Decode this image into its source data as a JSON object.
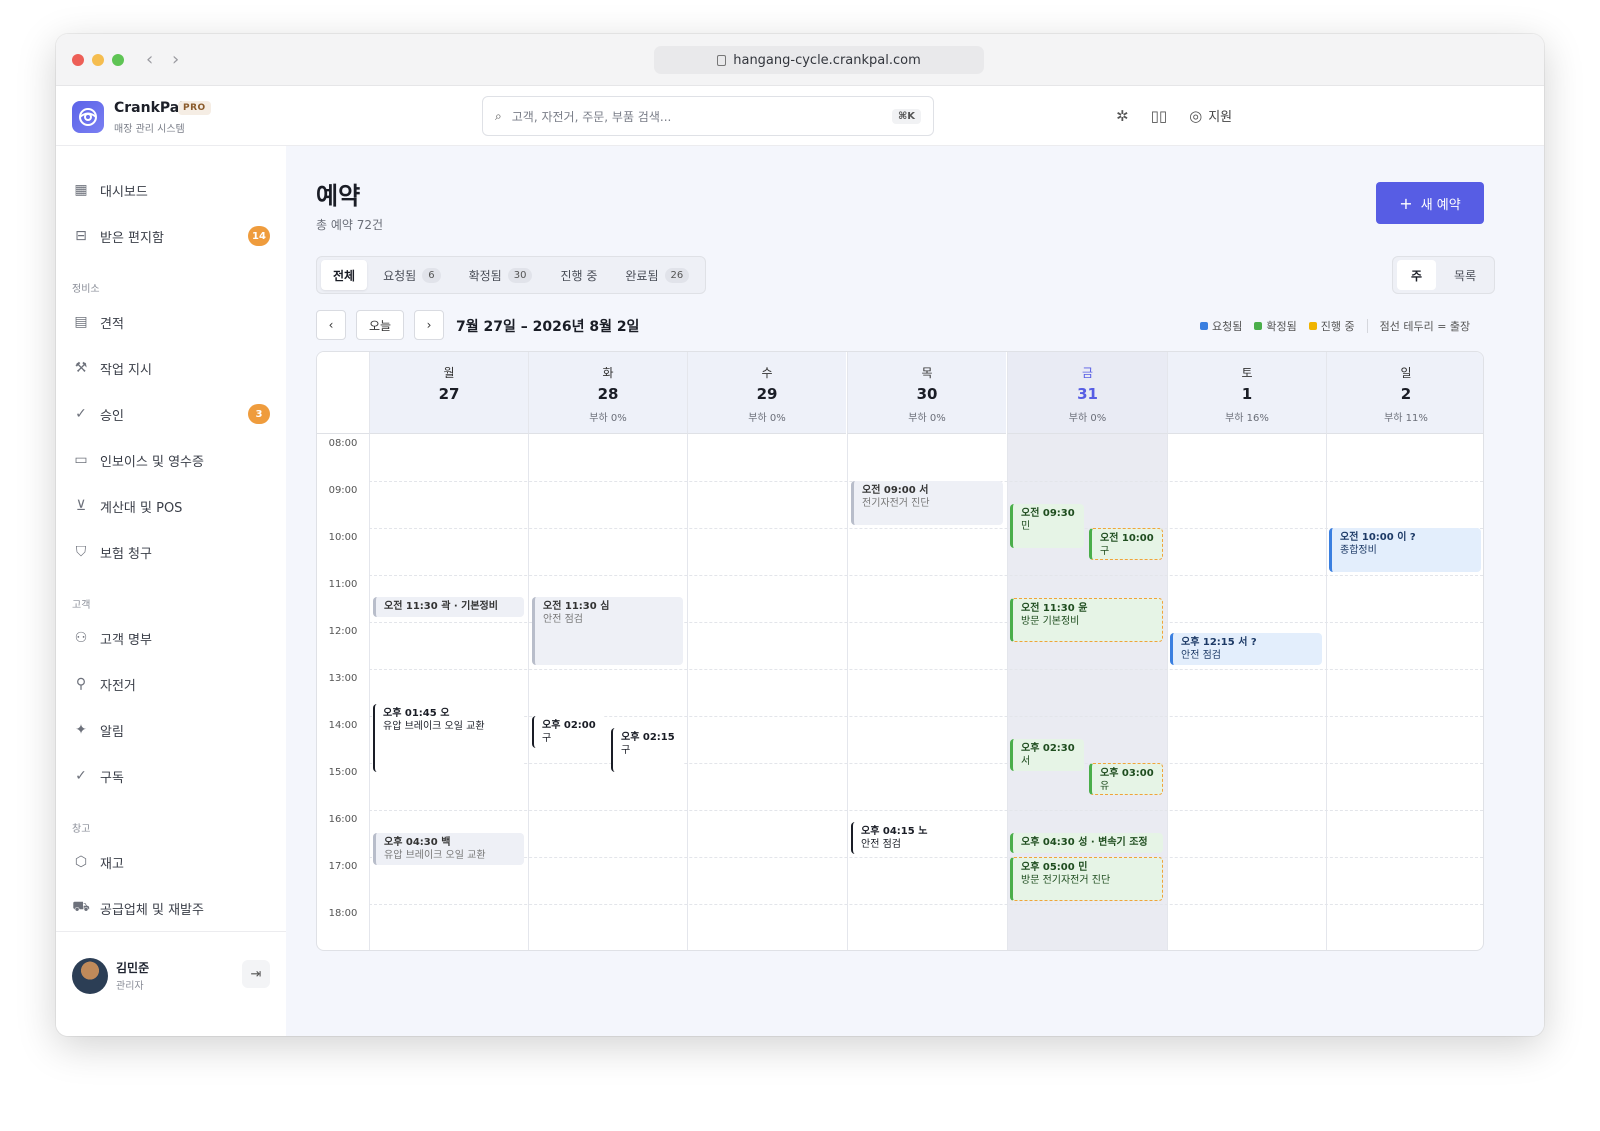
{
  "browser": {
    "url": "hangang-cycle.crankpal.com"
  },
  "brand": {
    "name": "CrankPal",
    "badge": "PRO",
    "subtitle": "매장 관리 시스템"
  },
  "search": {
    "placeholder": "고객, 자전거, 주문, 부품 검색...",
    "shortcut": "⌘K"
  },
  "topbar": {
    "support_label": "지원"
  },
  "sidebar": {
    "items": [
      {
        "label": "대시보드",
        "icon": "grid-icon"
      },
      {
        "label": "받은 편지함",
        "icon": "inbox-icon",
        "badge": "14"
      }
    ],
    "sections": [
      {
        "title": "정비소",
        "items": [
          {
            "label": "견적",
            "icon": "document-icon"
          },
          {
            "label": "작업 지시",
            "icon": "wrench-icon"
          },
          {
            "label": "승인",
            "icon": "check-circle-icon",
            "badge": "3"
          },
          {
            "label": "인보이스 및 영수증",
            "icon": "receipt-icon"
          },
          {
            "label": "계산대 및 POS",
            "icon": "cart-icon"
          },
          {
            "label": "보험 청구",
            "icon": "shield-icon"
          }
        ]
      },
      {
        "title": "고객",
        "items": [
          {
            "label": "고객 명부",
            "icon": "users-icon"
          },
          {
            "label": "자전거",
            "icon": "bicycle-icon"
          },
          {
            "label": "알림",
            "icon": "sparkle-icon"
          },
          {
            "label": "구독",
            "icon": "check-circle-icon"
          }
        ]
      },
      {
        "title": "창고",
        "items": [
          {
            "label": "재고",
            "icon": "box-icon"
          },
          {
            "label": "공급업체 및 재발주",
            "icon": "truck-icon"
          }
        ]
      }
    ]
  },
  "user": {
    "name": "김민준",
    "role": "관리자"
  },
  "page": {
    "title": "예약",
    "subtitle": "총 예약 72건",
    "new_button": "새 예약"
  },
  "tabs": [
    {
      "label": "전체",
      "count": ""
    },
    {
      "label": "요청됨",
      "count": "6"
    },
    {
      "label": "확정됨",
      "count": "30"
    },
    {
      "label": "진행 중",
      "count": ""
    },
    {
      "label": "완료됨",
      "count": "26"
    }
  ],
  "view_toggle": [
    "주",
    "목록"
  ],
  "nav": {
    "prev": "‹",
    "today": "오늘",
    "next": "›",
    "range": "7월 27일 – 2026년 8월 2일"
  },
  "legend": {
    "items": [
      {
        "label": "요청됨",
        "color": "#3a7fe0"
      },
      {
        "label": "확정됨",
        "color": "#4aae4a"
      },
      {
        "label": "진행 중",
        "color": "#f0b400"
      }
    ],
    "note": "점선 테두리 = 출장"
  },
  "calendar": {
    "hours": [
      "08:00",
      "09:00",
      "10:00",
      "11:00",
      "12:00",
      "13:00",
      "14:00",
      "15:00",
      "16:00",
      "17:00",
      "18:00"
    ],
    "days": [
      {
        "name": "월",
        "date": "27",
        "load": ""
      },
      {
        "name": "화",
        "date": "28",
        "load": "부하 0%"
      },
      {
        "name": "수",
        "date": "29",
        "load": "부하 0%"
      },
      {
        "name": "목",
        "date": "30",
        "load": "부하 0%"
      },
      {
        "name": "금",
        "date": "31",
        "load": "부하 0%"
      },
      {
        "name": "토",
        "date": "1",
        "load": "부하 16%"
      },
      {
        "name": "일",
        "date": "2",
        "load": "부하 11%"
      }
    ],
    "events": [
      {
        "title": "오전 11:30 곽 · 기본정비",
        "sub": ""
      },
      {
        "title": "오후 01:45 오",
        "sub": "유압 브레이크 오일 교환"
      },
      {
        "title": "오후 04:30 백",
        "sub": "유압 브레이크 오일 교환"
      },
      {
        "title": "오전 11:30 심",
        "sub": "안전 점검"
      },
      {
        "title": "오후 02:00",
        "sub": "구"
      },
      {
        "title": "오후 02:15",
        "sub": "구"
      },
      {
        "title": "오전 09:00 서",
        "sub": "전기자전거 진단"
      },
      {
        "title": "오후 04:15 노",
        "sub": "안전 점검"
      },
      {
        "title": "오전 09:30",
        "sub": "민"
      },
      {
        "title": "오전 10:00",
        "sub": "구"
      },
      {
        "title": "오전 11:30 윤",
        "sub": "방문 기본정비"
      },
      {
        "title": "오후 02:30",
        "sub": "서"
      },
      {
        "title": "오후 03:00",
        "sub": "유"
      },
      {
        "title": "오후 04:30 성 · 변속기 조정",
        "sub": ""
      },
      {
        "title": "오후 05:00 민",
        "sub": "방문 전기자전거 진단"
      },
      {
        "title": "오후 12:15 서 ?",
        "sub": "안전 점검"
      },
      {
        "title": "오전 10:00 이 ?",
        "sub": "종합정비"
      }
    ]
  }
}
